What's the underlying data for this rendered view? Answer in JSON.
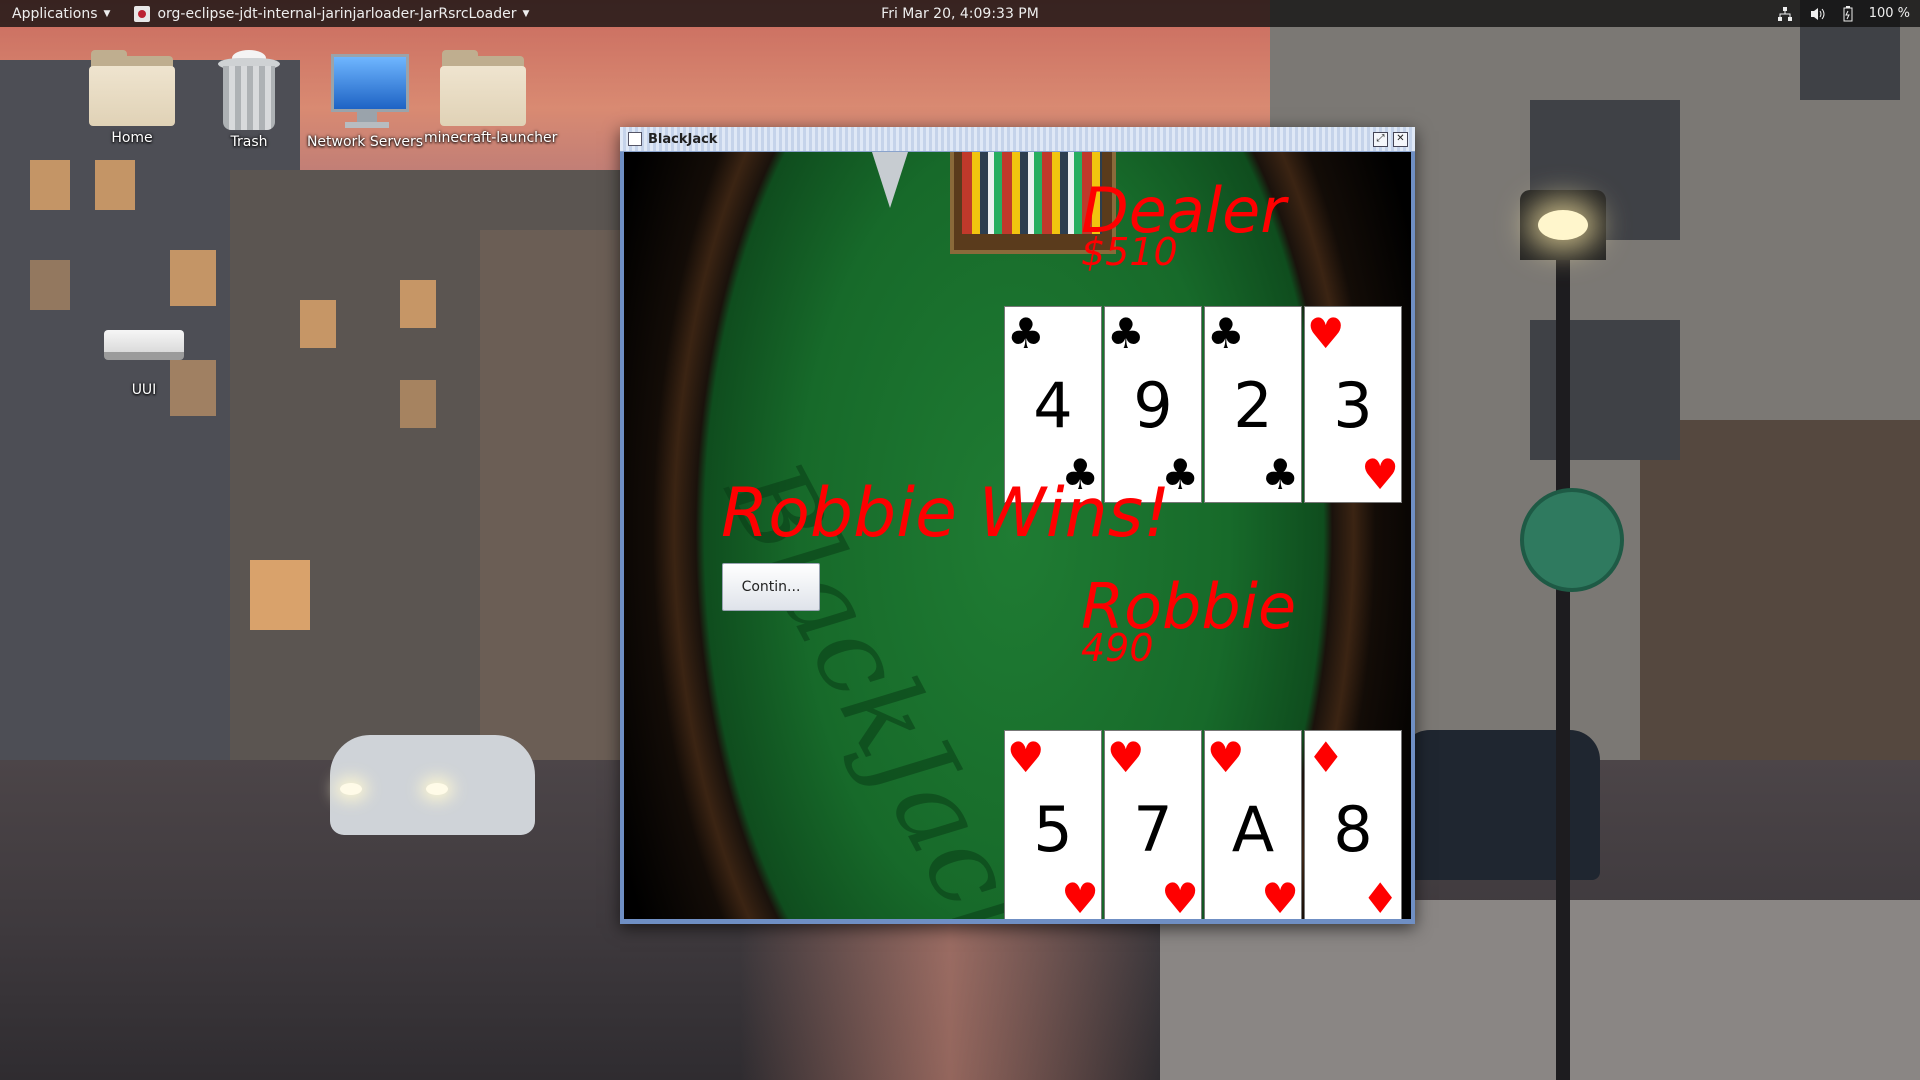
{
  "panel": {
    "applications_label": "Applications",
    "active_app_label": "org-eclipse-jdt-internal-jarinjarloader-JarRsrcLoader",
    "clock": "Fri Mar 20,  4:09:33 PM",
    "battery": "100 %"
  },
  "desktop_icons": [
    {
      "label": "Home",
      "icon": "home-folder-icon"
    },
    {
      "label": "Trash",
      "icon": "trash-icon"
    },
    {
      "label": "Network Servers",
      "icon": "network-servers-icon"
    },
    {
      "label": "minecraft-launcher",
      "icon": "folder-icon"
    },
    {
      "label": "UUI",
      "icon": "drive-icon"
    }
  ],
  "window": {
    "title": "BlackJack"
  },
  "game": {
    "dealer": {
      "name": "Dealer",
      "money": "$510",
      "cards": [
        {
          "rank": "4",
          "suit": "♣",
          "color": "black"
        },
        {
          "rank": "9",
          "suit": "♣",
          "color": "black"
        },
        {
          "rank": "2",
          "suit": "♣",
          "color": "black"
        },
        {
          "rank": "3",
          "suit": "♥",
          "color": "red"
        }
      ]
    },
    "player": {
      "name": "Robbie",
      "money": "490",
      "cards": [
        {
          "rank": "5",
          "suit": "♥",
          "color": "red"
        },
        {
          "rank": "7",
          "suit": "♥",
          "color": "red"
        },
        {
          "rank": "A",
          "suit": "♥",
          "color": "red"
        },
        {
          "rank": "8",
          "suit": "♦",
          "color": "red"
        }
      ]
    },
    "result_text": "Robbie Wins!",
    "continue_label": "Contin..."
  },
  "colors": {
    "game_text": "#ff0000",
    "felt": "#1f7c33",
    "panel": "#101010"
  }
}
